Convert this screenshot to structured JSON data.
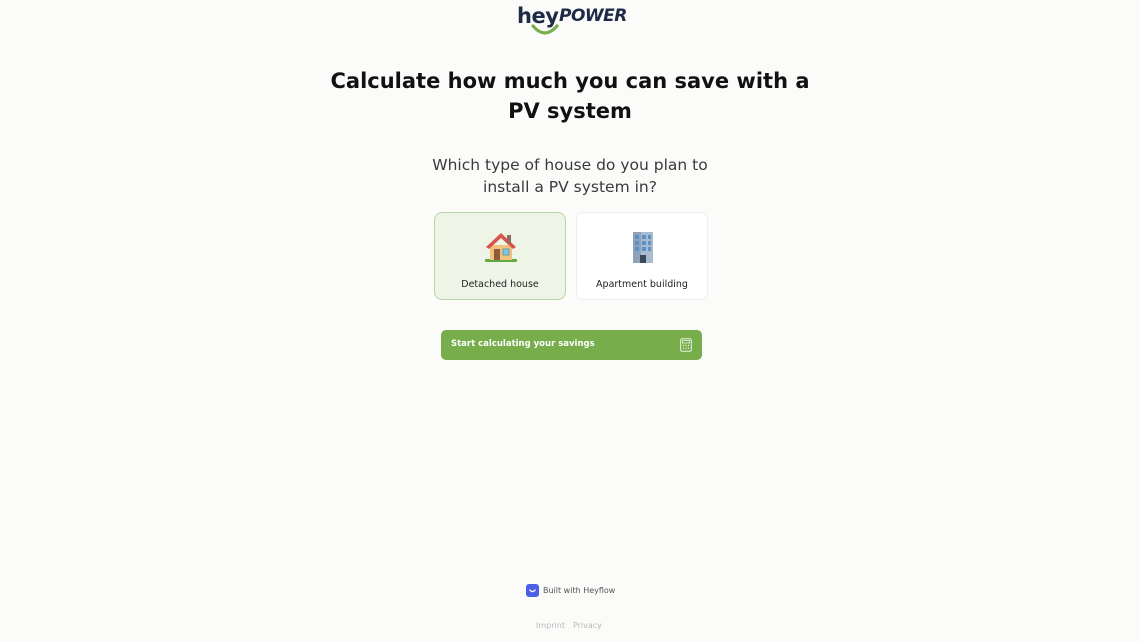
{
  "brand": {
    "logo_hey": "hey",
    "logo_power": "POWER",
    "accent_color": "#77ad4b",
    "logo_text_color": "#1f2a44"
  },
  "main": {
    "headline": "Calculate how much you can save with a PV system",
    "question": "Which type of house do you plan to install a PV system in?"
  },
  "options": [
    {
      "label": "Detached house",
      "icon": "house-icon",
      "selected": true
    },
    {
      "label": "Apartment building",
      "icon": "apartment-building-icon",
      "selected": false
    }
  ],
  "cta": {
    "label": "Start calculating your savings",
    "icon": "calculator-icon"
  },
  "footer": {
    "built_with": "Built with Heyflow",
    "imprint": "Imprint",
    "privacy": "Privacy"
  }
}
